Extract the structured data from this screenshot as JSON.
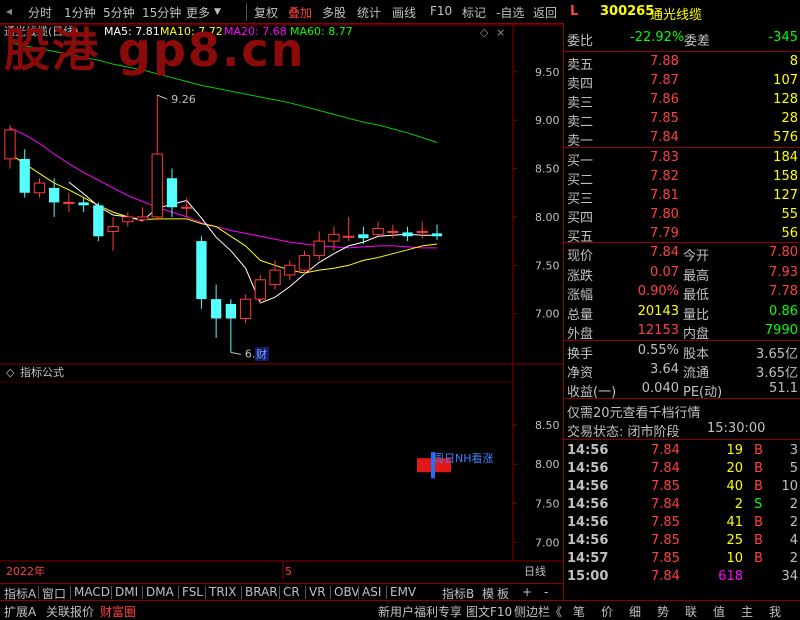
{
  "toolbar": {
    "left_items": [
      "分时",
      "1分钟",
      "5分钟",
      "15分钟",
      "更多"
    ],
    "right_items": [
      "复权",
      "叠加",
      "多股",
      "统计",
      "画线",
      "F10",
      "标记",
      "-自选",
      "返回"
    ]
  },
  "watermark": "股港  gp8.cn",
  "chart_header": {
    "name": "通光线缆(日线)",
    "ma": [
      {
        "label": "MA5: 7.81",
        "color": "#ffffff"
      },
      {
        "label": "MA10: 7.72",
        "color": "#ffff00"
      },
      {
        "label": "MA20: 7.68",
        "color": "#ff00ff"
      },
      {
        "label": "MA60: 8.77",
        "color": "#00ff00"
      }
    ]
  },
  "indicator_header": "指标公式",
  "indicator_note": "周日NH看涨",
  "price_annotations": {
    "high": "9.26",
    "low": "6.60",
    "badge": "财"
  },
  "x_axis": {
    "left": "2022年",
    "mid": "5",
    "right": "日线"
  },
  "chart_data": {
    "type": "candlestick",
    "ylim": [
      6.5,
      9.85
    ],
    "yticks": [
      7.0,
      7.5,
      8.0,
      8.5,
      9.0,
      9.5
    ],
    "sub_ylim": [
      6.8,
      9.0
    ],
    "sub_yticks": [
      7.0,
      7.5,
      8.0,
      8.5
    ],
    "candles": [
      [
        8.6,
        8.9,
        8.95,
        8.5
      ],
      [
        8.6,
        8.25,
        8.7,
        8.2
      ],
      [
        8.25,
        8.35,
        8.4,
        8.2
      ],
      [
        8.3,
        8.15,
        8.4,
        8.0
      ],
      [
        8.15,
        8.15,
        8.25,
        8.05
      ],
      [
        8.15,
        8.12,
        8.2,
        8.05
      ],
      [
        8.12,
        7.8,
        8.15,
        7.75
      ],
      [
        7.85,
        7.9,
        8.0,
        7.65
      ],
      [
        7.95,
        8.0,
        8.05,
        7.9
      ],
      [
        7.97,
        8.0,
        8.1,
        7.95
      ],
      [
        8.0,
        8.65,
        9.26,
        7.97
      ],
      [
        8.4,
        8.1,
        8.5,
        8.0
      ],
      [
        8.1,
        8.1,
        8.2,
        8.0
      ],
      [
        7.75,
        7.15,
        7.8,
        7.05
      ],
      [
        7.15,
        6.95,
        7.3,
        6.75
      ],
      [
        7.1,
        6.95,
        7.15,
        6.6
      ],
      [
        6.95,
        7.15,
        7.2,
        6.9
      ],
      [
        7.15,
        7.35,
        7.4,
        7.1
      ],
      [
        7.3,
        7.45,
        7.55,
        7.25
      ],
      [
        7.4,
        7.5,
        7.55,
        7.35
      ],
      [
        7.45,
        7.6,
        7.65,
        7.4
      ],
      [
        7.6,
        7.75,
        7.85,
        7.55
      ],
      [
        7.75,
        7.82,
        7.9,
        7.65
      ],
      [
        7.8,
        7.8,
        8.0,
        7.75
      ],
      [
        7.82,
        7.78,
        7.9,
        7.72
      ],
      [
        7.82,
        7.88,
        7.95,
        7.8
      ],
      [
        7.85,
        7.85,
        7.92,
        7.78
      ],
      [
        7.84,
        7.8,
        7.9,
        7.75
      ],
      [
        7.84,
        7.85,
        7.95,
        7.78
      ],
      [
        7.83,
        7.8,
        7.92,
        7.76
      ]
    ],
    "ma5": [
      null,
      null,
      null,
      null,
      8.36,
      8.24,
      8.11,
      8.02,
      8.0,
      7.96,
      8.09,
      8.13,
      8.17,
      7.99,
      7.79,
      7.65,
      7.47,
      7.11,
      7.17,
      7.28,
      7.41,
      7.53,
      7.62,
      7.7,
      7.74,
      7.8,
      7.81,
      7.82,
      7.81,
      7.81
    ],
    "ma10": [
      8.65,
      8.55,
      8.45,
      8.35,
      8.28,
      8.2,
      8.12,
      8.05,
      8.0,
      7.97,
      7.98,
      7.98,
      7.98,
      7.93,
      7.9,
      7.8,
      7.7,
      7.55,
      7.5,
      7.45,
      7.42,
      7.45,
      7.47,
      7.5,
      7.55,
      7.58,
      7.62,
      7.66,
      7.7,
      7.72
    ],
    "ma20": [
      8.92,
      8.85,
      8.76,
      8.65,
      8.55,
      8.46,
      8.38,
      8.3,
      8.22,
      8.16,
      8.1,
      8.05,
      8.0,
      7.94,
      7.9,
      7.86,
      7.83,
      7.8,
      7.77,
      7.74,
      7.72,
      7.7,
      7.69,
      7.68,
      7.69,
      7.7,
      7.7,
      7.69,
      7.68,
      7.68
    ],
    "ma60": [
      9.8,
      9.77,
      9.74,
      9.71,
      9.68,
      9.65,
      9.62,
      9.58,
      9.55,
      9.52,
      9.48,
      9.44,
      9.4,
      9.36,
      9.33,
      9.3,
      9.27,
      9.24,
      9.21,
      9.18,
      9.14,
      9.1,
      9.06,
      9.02,
      8.98,
      8.95,
      8.91,
      8.87,
      8.82,
      8.77
    ]
  },
  "quote": {
    "code": "300265",
    "name": "通光线缆",
    "weibi_label": "委比",
    "weibi": "-22.92%",
    "weicha_label": "委差",
    "weicha": "-345",
    "sells": [
      {
        "label": "卖五",
        "price": "7.88",
        "vol": "8"
      },
      {
        "label": "卖四",
        "price": "7.87",
        "vol": "107"
      },
      {
        "label": "卖三",
        "price": "7.86",
        "vol": "128"
      },
      {
        "label": "卖二",
        "price": "7.85",
        "vol": "28"
      },
      {
        "label": "卖一",
        "price": "7.84",
        "vol": "576"
      }
    ],
    "buys": [
      {
        "label": "买一",
        "price": "7.83",
        "vol": "184"
      },
      {
        "label": "买二",
        "price": "7.82",
        "vol": "158"
      },
      {
        "label": "买三",
        "price": "7.81",
        "vol": "127"
      },
      {
        "label": "买四",
        "price": "7.80",
        "vol": "55"
      },
      {
        "label": "买五",
        "price": "7.79",
        "vol": "56"
      }
    ],
    "stats": [
      {
        "l1": "现价",
        "v1": "7.84",
        "c1": "#ff4040",
        "l2": "今开",
        "v2": "7.80",
        "c2": "#ff4040"
      },
      {
        "l1": "涨跌",
        "v1": "0.07",
        "c1": "#ff4040",
        "l2": "最高",
        "v2": "7.93",
        "c2": "#ff4040"
      },
      {
        "l1": "涨幅",
        "v1": "0.90%",
        "c1": "#ff4040",
        "l2": "最低",
        "v2": "7.78",
        "c2": "#ff4040"
      },
      {
        "l1": "总量",
        "v1": "20143",
        "c1": "#ffff00",
        "l2": "量比",
        "v2": "0.86",
        "c2": "#00ff00"
      },
      {
        "l1": "外盘",
        "v1": "12153",
        "c1": "#ff4040",
        "l2": "内盘",
        "v2": "7990",
        "c2": "#00ff00"
      }
    ],
    "stats2": [
      {
        "l1": "换手",
        "v1": "0.55%",
        "l2": "股本",
        "v2": "3.65亿"
      },
      {
        "l1": "净资",
        "v1": "3.64",
        "l2": "流通",
        "v2": "3.65亿"
      },
      {
        "l1": "收益(一)",
        "v1": "0.040",
        "l2": "PE(动)",
        "v2": "51.1"
      }
    ],
    "promo": "仅需20元查看千档行情",
    "trade_state": "交易状态: 闭市阶段",
    "trade_time": "15:30:00",
    "ticks": [
      {
        "t": "14:56",
        "p": "7.84",
        "v": "19",
        "bs": "B",
        "n": "3",
        "vc": "#ffff00"
      },
      {
        "t": "14:56",
        "p": "7.84",
        "v": "20",
        "bs": "B",
        "n": "5",
        "vc": "#ffff00"
      },
      {
        "t": "14:56",
        "p": "7.85",
        "v": "40",
        "bs": "B",
        "n": "10",
        "vc": "#ffff00"
      },
      {
        "t": "14:56",
        "p": "7.84",
        "v": "2",
        "bs": "S",
        "n": "2",
        "vc": "#ffff00"
      },
      {
        "t": "14:56",
        "p": "7.85",
        "v": "41",
        "bs": "B",
        "n": "2",
        "vc": "#ffff00"
      },
      {
        "t": "14:56",
        "p": "7.85",
        "v": "25",
        "bs": "B",
        "n": "4",
        "vc": "#ffff00"
      },
      {
        "t": "14:57",
        "p": "7.85",
        "v": "10",
        "bs": "B",
        "n": "2",
        "vc": "#ffff00"
      },
      {
        "t": "15:00",
        "p": "7.84",
        "v": "618",
        "bs": "",
        "n": "34",
        "vc": "#ff00ff"
      }
    ]
  },
  "bottom_tabs": [
    "指标A",
    "窗口",
    "MACD",
    "DMI",
    "DMA",
    "FSL",
    "TRIX",
    "BRAR",
    "CR",
    "VR",
    "OBV",
    "ASI",
    "EMV"
  ],
  "bottom_right": [
    "指标B",
    "模",
    "板"
  ],
  "status_left": [
    "扩展A",
    "关联报价",
    "财富圈"
  ],
  "status_mid": [
    "新用户福利专享",
    "图文F10",
    "侧边栏《"
  ],
  "status_right": [
    "笔",
    "价",
    "细",
    "势",
    "联",
    "值",
    "主",
    "我"
  ]
}
